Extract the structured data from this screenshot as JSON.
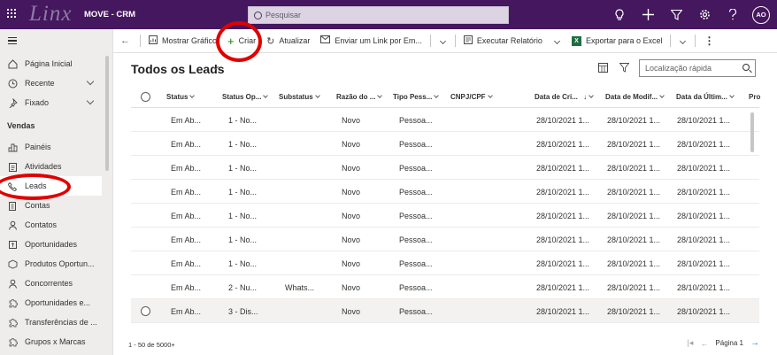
{
  "topbar": {
    "logo": "Linx",
    "app_name": "MOVE - CRM",
    "search_placeholder": "Pesquisar",
    "avatar_initials": "AO"
  },
  "sidebar": {
    "top_items": [
      {
        "label": "Página Inicial",
        "icon": "home-icon"
      },
      {
        "label": "Recente",
        "icon": "clock-icon"
      },
      {
        "label": "Fixado",
        "icon": "pin-icon"
      }
    ],
    "section": "Vendas",
    "items": [
      {
        "label": "Painéis",
        "icon": "dashboard-icon"
      },
      {
        "label": "Atividades",
        "icon": "clipboard-icon"
      },
      {
        "label": "Leads",
        "icon": "phone-icon"
      },
      {
        "label": "Contas",
        "icon": "building-icon"
      },
      {
        "label": "Contatos",
        "icon": "person-icon"
      },
      {
        "label": "Oportunidades",
        "icon": "opportunity-icon"
      },
      {
        "label": "Produtos Oportun...",
        "icon": "product-icon"
      },
      {
        "label": "Concorrentes",
        "icon": "person-icon"
      },
      {
        "label": "Oportunidades e...",
        "icon": "puzzle-icon"
      },
      {
        "label": "Transferências de ...",
        "icon": "puzzle-icon"
      },
      {
        "label": "Grupos x Marcas",
        "icon": "puzzle-icon"
      }
    ]
  },
  "commandbar": {
    "show_chart": "Mostrar Gráfico",
    "create": "Criar",
    "refresh": "Atualizar",
    "send_link": "Enviar um Link por Em...",
    "run_report": "Executar Relatório",
    "export_excel": "Exportar para o Excel"
  },
  "view": {
    "title": "Todos os Leads",
    "quick_find_placeholder": "Localização rápida",
    "columns": [
      "Status",
      "Status Op...",
      "Substatus",
      "Razão do ...",
      "Tipo Pess...",
      "CNPJ/CPF",
      "Data de Cri...",
      "Data de Modif...",
      "Data da Últim...",
      "Pro"
    ],
    "rows": [
      [
        "Em Ab...",
        "1 - No...",
        "",
        "Novo",
        "Pessoa...",
        "",
        "28/10/2021 1...",
        "28/10/2021 1...",
        "28/10/2021 1..."
      ],
      [
        "Em Ab...",
        "1 - No...",
        "",
        "Novo",
        "Pessoa...",
        "",
        "28/10/2021 1...",
        "28/10/2021 1...",
        "28/10/2021 1..."
      ],
      [
        "Em Ab...",
        "1 - No...",
        "",
        "Novo",
        "Pessoa...",
        "",
        "28/10/2021 1...",
        "28/10/2021 1...",
        "28/10/2021 1..."
      ],
      [
        "Em Ab...",
        "1 - No...",
        "",
        "Novo",
        "Pessoa...",
        "",
        "28/10/2021 1...",
        "28/10/2021 1...",
        "28/10/2021 1..."
      ],
      [
        "Em Ab...",
        "1 - No...",
        "",
        "Novo",
        "Pessoa...",
        "",
        "28/10/2021 1...",
        "28/10/2021 1...",
        "28/10/2021 1..."
      ],
      [
        "Em Ab...",
        "1 - No...",
        "",
        "Novo",
        "Pessoa...",
        "",
        "28/10/2021 1...",
        "28/10/2021 1...",
        "28/10/2021 1..."
      ],
      [
        "Em Ab...",
        "1 - No...",
        "",
        "Novo",
        "Pessoa...",
        "",
        "28/10/2021 1...",
        "28/10/2021 1...",
        "28/10/2021 1..."
      ],
      [
        "Em Ab...",
        "2 - Nu...",
        "Whats...",
        "Novo",
        "Pessoa...",
        "",
        "28/10/2021 1...",
        "28/10/2021 1...",
        "28/10/2021 1..."
      ],
      [
        "Em Ab...",
        "3 - Dis...",
        "",
        "Novo",
        "Pessoa...",
        "",
        "28/10/2021 1...",
        "28/10/2021 1...",
        "28/10/2021 1..."
      ]
    ],
    "record_count": "1 - 50 de 5000+",
    "page_label": "Página 1"
  },
  "colors": {
    "topbar": "#44175e",
    "annotation": "#e00000"
  }
}
